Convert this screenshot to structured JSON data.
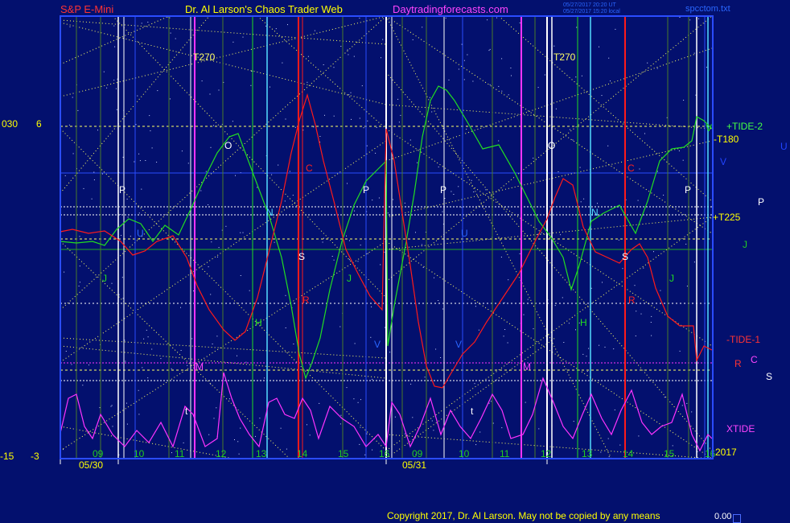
{
  "header": {
    "symbol": "S&P E-Mini",
    "publisher": "Dr. Al Larson's Chaos Trader Web",
    "website": "Daytradingforecasts.com",
    "stamp_ut": "05/27/2017 20:20 UT",
    "stamp_local": "05/27/2017 15:20 local",
    "file": "spcctom.txt"
  },
  "left_scale": {
    "upper_code": "030",
    "upper_value": "6",
    "lower_code": "-15",
    "lower_value": "-3"
  },
  "right_labels": {
    "tide2": "+TIDE-2",
    "t180": "-T180",
    "u": "U",
    "v": "V",
    "p": "P",
    "t225": "+T225",
    "j": "J",
    "tide1": "-TIDE-1",
    "r": "R",
    "c": "C",
    "s": "S",
    "xtide": "XTIDE",
    "year": "2017"
  },
  "footer": {
    "copyright": "Copyright 2017, Dr. Al Larson. May not be copied by any means",
    "tail_value": "0.00"
  },
  "colors": {
    "background": "#03106e",
    "plot_border": "#2a4cff",
    "grid_dotted": "#ffff66",
    "green_line": "#22dd22",
    "red_line": "#ff1a1a",
    "magenta_line": "#ff33ff",
    "cyan_line": "#55ddff",
    "white_line": "#ffffff",
    "header_red": "#ff3333",
    "header_yellow": "#ffff00",
    "header_magenta": "#ff44ff"
  },
  "chart_data": {
    "type": "line",
    "title": "S&P E-Mini",
    "days": [
      {
        "date": "05/30",
        "hours": [
          "09",
          "10",
          "11",
          "12",
          "13",
          "14",
          "15",
          "16"
        ]
      },
      {
        "date": "05/31",
        "hours": [
          "09",
          "10",
          "11",
          "12",
          "13",
          "14",
          "15",
          "16"
        ]
      }
    ],
    "left_axis_ticks": [
      6,
      -3
    ],
    "series": [
      {
        "name": "+TIDE-2",
        "color": "#22dd22"
      },
      {
        "name": "-TIDE-1",
        "color": "#ff1a1a"
      },
      {
        "name": "XTIDE",
        "color": "#ff33ff"
      }
    ],
    "time_lines": [
      {
        "label": "T270",
        "color": "white"
      },
      {
        "label": "T270",
        "color": "white"
      }
    ],
    "day1_markers": [
      {
        "label": "P",
        "color": "white"
      },
      {
        "label": "P",
        "color": "white"
      },
      {
        "label": "O",
        "color": "white"
      },
      {
        "label": "N",
        "color": "cyan"
      },
      {
        "label": "S",
        "color": "white"
      },
      {
        "label": "C",
        "color": "red"
      },
      {
        "label": "R",
        "color": "red"
      },
      {
        "label": "H",
        "color": "green"
      },
      {
        "label": "J",
        "color": "green"
      },
      {
        "label": "J",
        "color": "green"
      },
      {
        "label": "M",
        "color": "magenta"
      },
      {
        "label": "U",
        "color": "blue"
      },
      {
        "label": "V",
        "color": "blue"
      },
      {
        "label": "t",
        "color": "white"
      }
    ],
    "day2_markers": [
      {
        "label": "P",
        "color": "white"
      },
      {
        "label": "P",
        "color": "white"
      },
      {
        "label": "O",
        "color": "white"
      },
      {
        "label": "N",
        "color": "cyan"
      },
      {
        "label": "S",
        "color": "white"
      },
      {
        "label": "C",
        "color": "red"
      },
      {
        "label": "R",
        "color": "red"
      },
      {
        "label": "H",
        "color": "green"
      },
      {
        "label": "J",
        "color": "green"
      },
      {
        "label": "M",
        "color": "magenta"
      },
      {
        "label": "U",
        "color": "blue"
      },
      {
        "label": "V",
        "color": "blue"
      },
      {
        "label": "t",
        "color": "white"
      },
      {
        "label": "V",
        "color": "green"
      }
    ]
  }
}
